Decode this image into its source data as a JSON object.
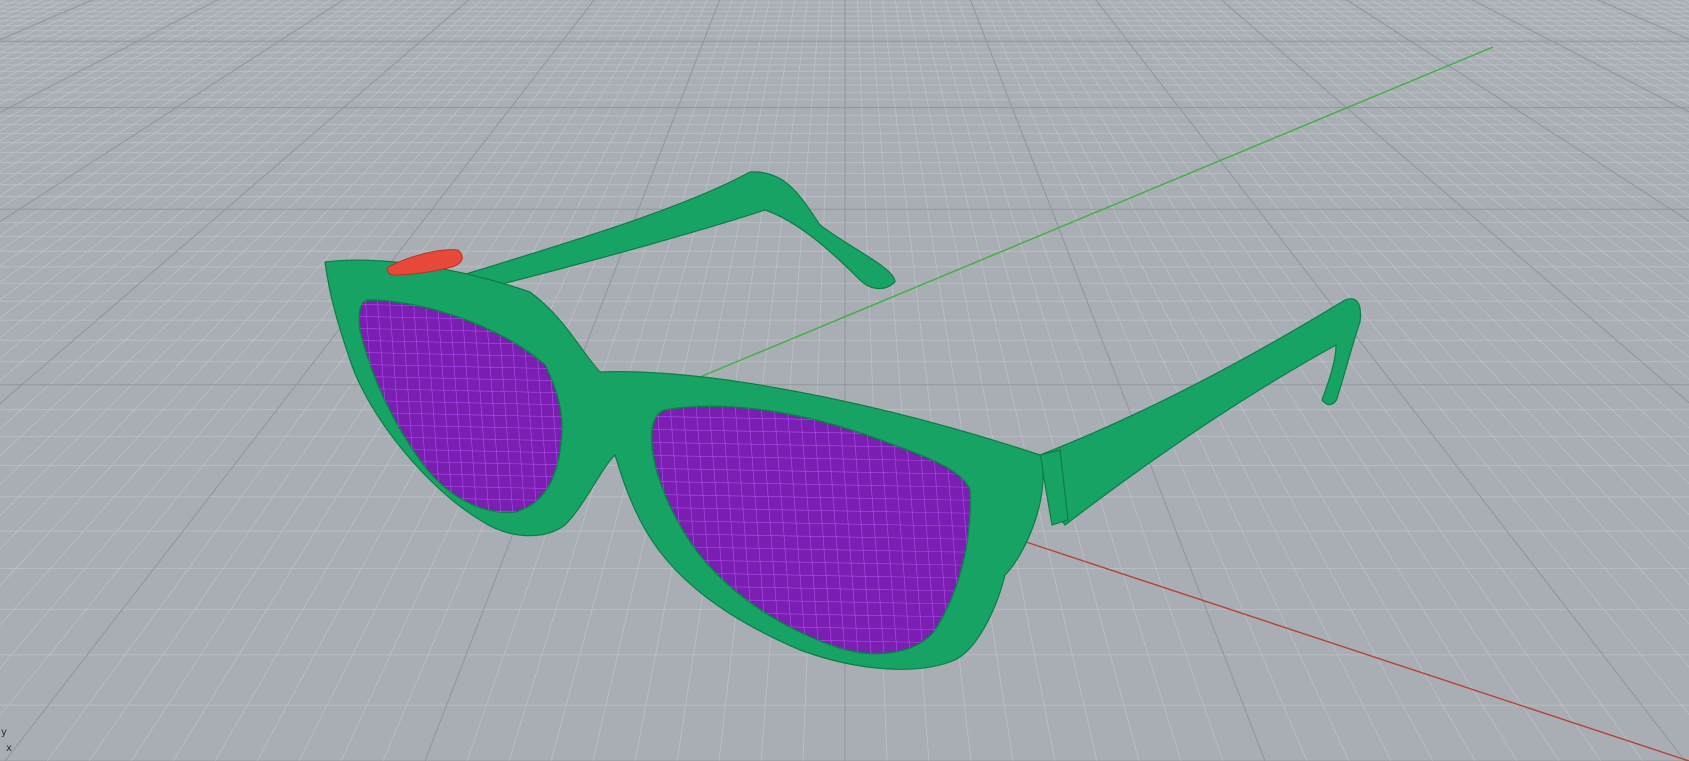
{
  "viewport": {
    "background_color": "#a9aeb4",
    "grid_minor_color": "#bcc1c6",
    "grid_major_color": "#8f959b",
    "axis_x_color": "#b5433a",
    "axis_y_color": "#3fb043"
  },
  "model": {
    "frame_color": "#16a363",
    "frame_wire_color": "#0d7d48",
    "lens_color": "#7a1fb2",
    "lens_wire_color": "#b04cf0",
    "selection_color": "#e8493a"
  },
  "axis_labels": {
    "y": "y",
    "x": "x"
  }
}
